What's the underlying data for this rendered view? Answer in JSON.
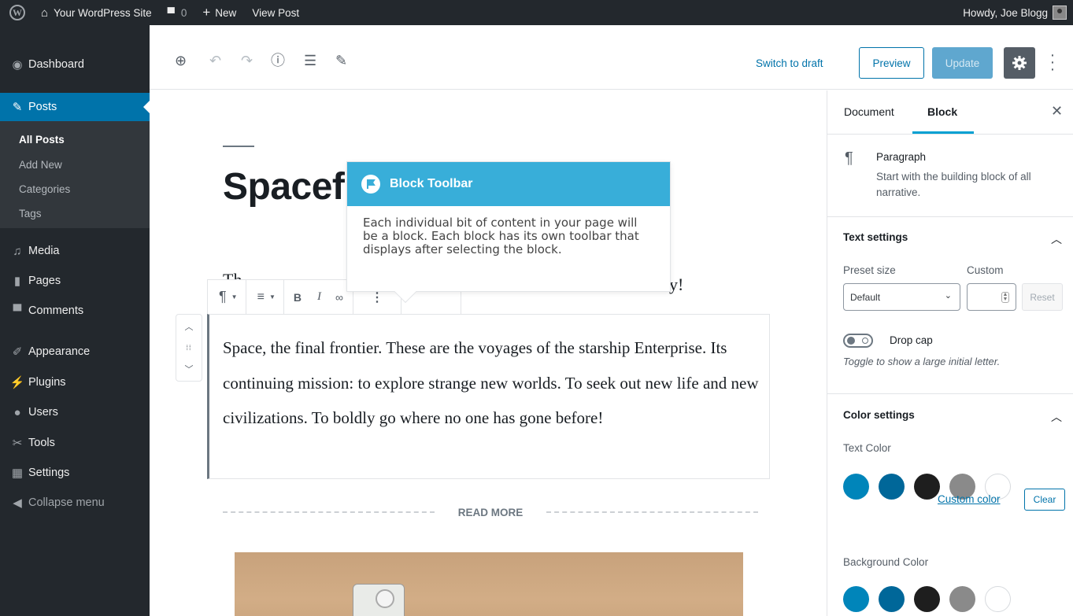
{
  "adminbar": {
    "site_name": "Your WordPress Site",
    "comments_count": "0",
    "new_label": "New",
    "view_post": "View Post",
    "howdy": "Howdy, Joe Blogg"
  },
  "sidebar": {
    "items": [
      {
        "label": "Dashboard",
        "icon": "dashboard-icon"
      },
      {
        "label": "Posts",
        "icon": "pin-icon"
      },
      {
        "label": "Media",
        "icon": "media-icon"
      },
      {
        "label": "Pages",
        "icon": "page-icon"
      },
      {
        "label": "Comments",
        "icon": "comment-icon"
      },
      {
        "label": "Appearance",
        "icon": "brush-icon"
      },
      {
        "label": "Plugins",
        "icon": "plugin-icon"
      },
      {
        "label": "Users",
        "icon": "user-icon"
      },
      {
        "label": "Tools",
        "icon": "wrench-icon"
      },
      {
        "label": "Settings",
        "icon": "settings-icon"
      },
      {
        "label": "Collapse menu",
        "icon": "collapse-icon"
      }
    ],
    "submenu": [
      "All Posts",
      "Add New",
      "Categories",
      "Tags"
    ]
  },
  "header": {
    "switch_to_draft": "Switch to draft",
    "preview": "Preview",
    "update": "Update"
  },
  "editor": {
    "title": "Spacef",
    "prev_paragraph_start": "Th",
    "prev_paragraph_end": "y!",
    "paragraph": "Space, the final frontier. These are the voyages of the starship Enterprise. Its continuing mission: to explore strange new worlds. To seek out new life and new civilizations. To boldly go where no one has gone before!",
    "read_more": "READ MORE",
    "toolbar": {
      "bold": "B",
      "italic": "I"
    }
  },
  "tour": {
    "title": "Block Toolbar",
    "body": "Each individual bit of content in your page will be a block. Each block has its own toolbar that displays after selecting the block."
  },
  "settings": {
    "tab_document": "Document",
    "tab_block": "Block",
    "block_name": "Paragraph",
    "block_description": "Start with the building block of all narrative.",
    "text_settings": "Text settings",
    "preset_size": "Preset size",
    "custom": "Custom",
    "preset_value": "Default",
    "reset": "Reset",
    "drop_cap": "Drop cap",
    "drop_cap_help": "Toggle to show a large initial letter.",
    "color_settings": "Color settings",
    "text_color": "Text Color",
    "custom_color": "Custom color",
    "clear": "Clear",
    "background_color": "Background Color",
    "palette": [
      "#0085ba",
      "#006799",
      "#1e1e1e",
      "#8a8a8a",
      "#ffffff"
    ]
  }
}
